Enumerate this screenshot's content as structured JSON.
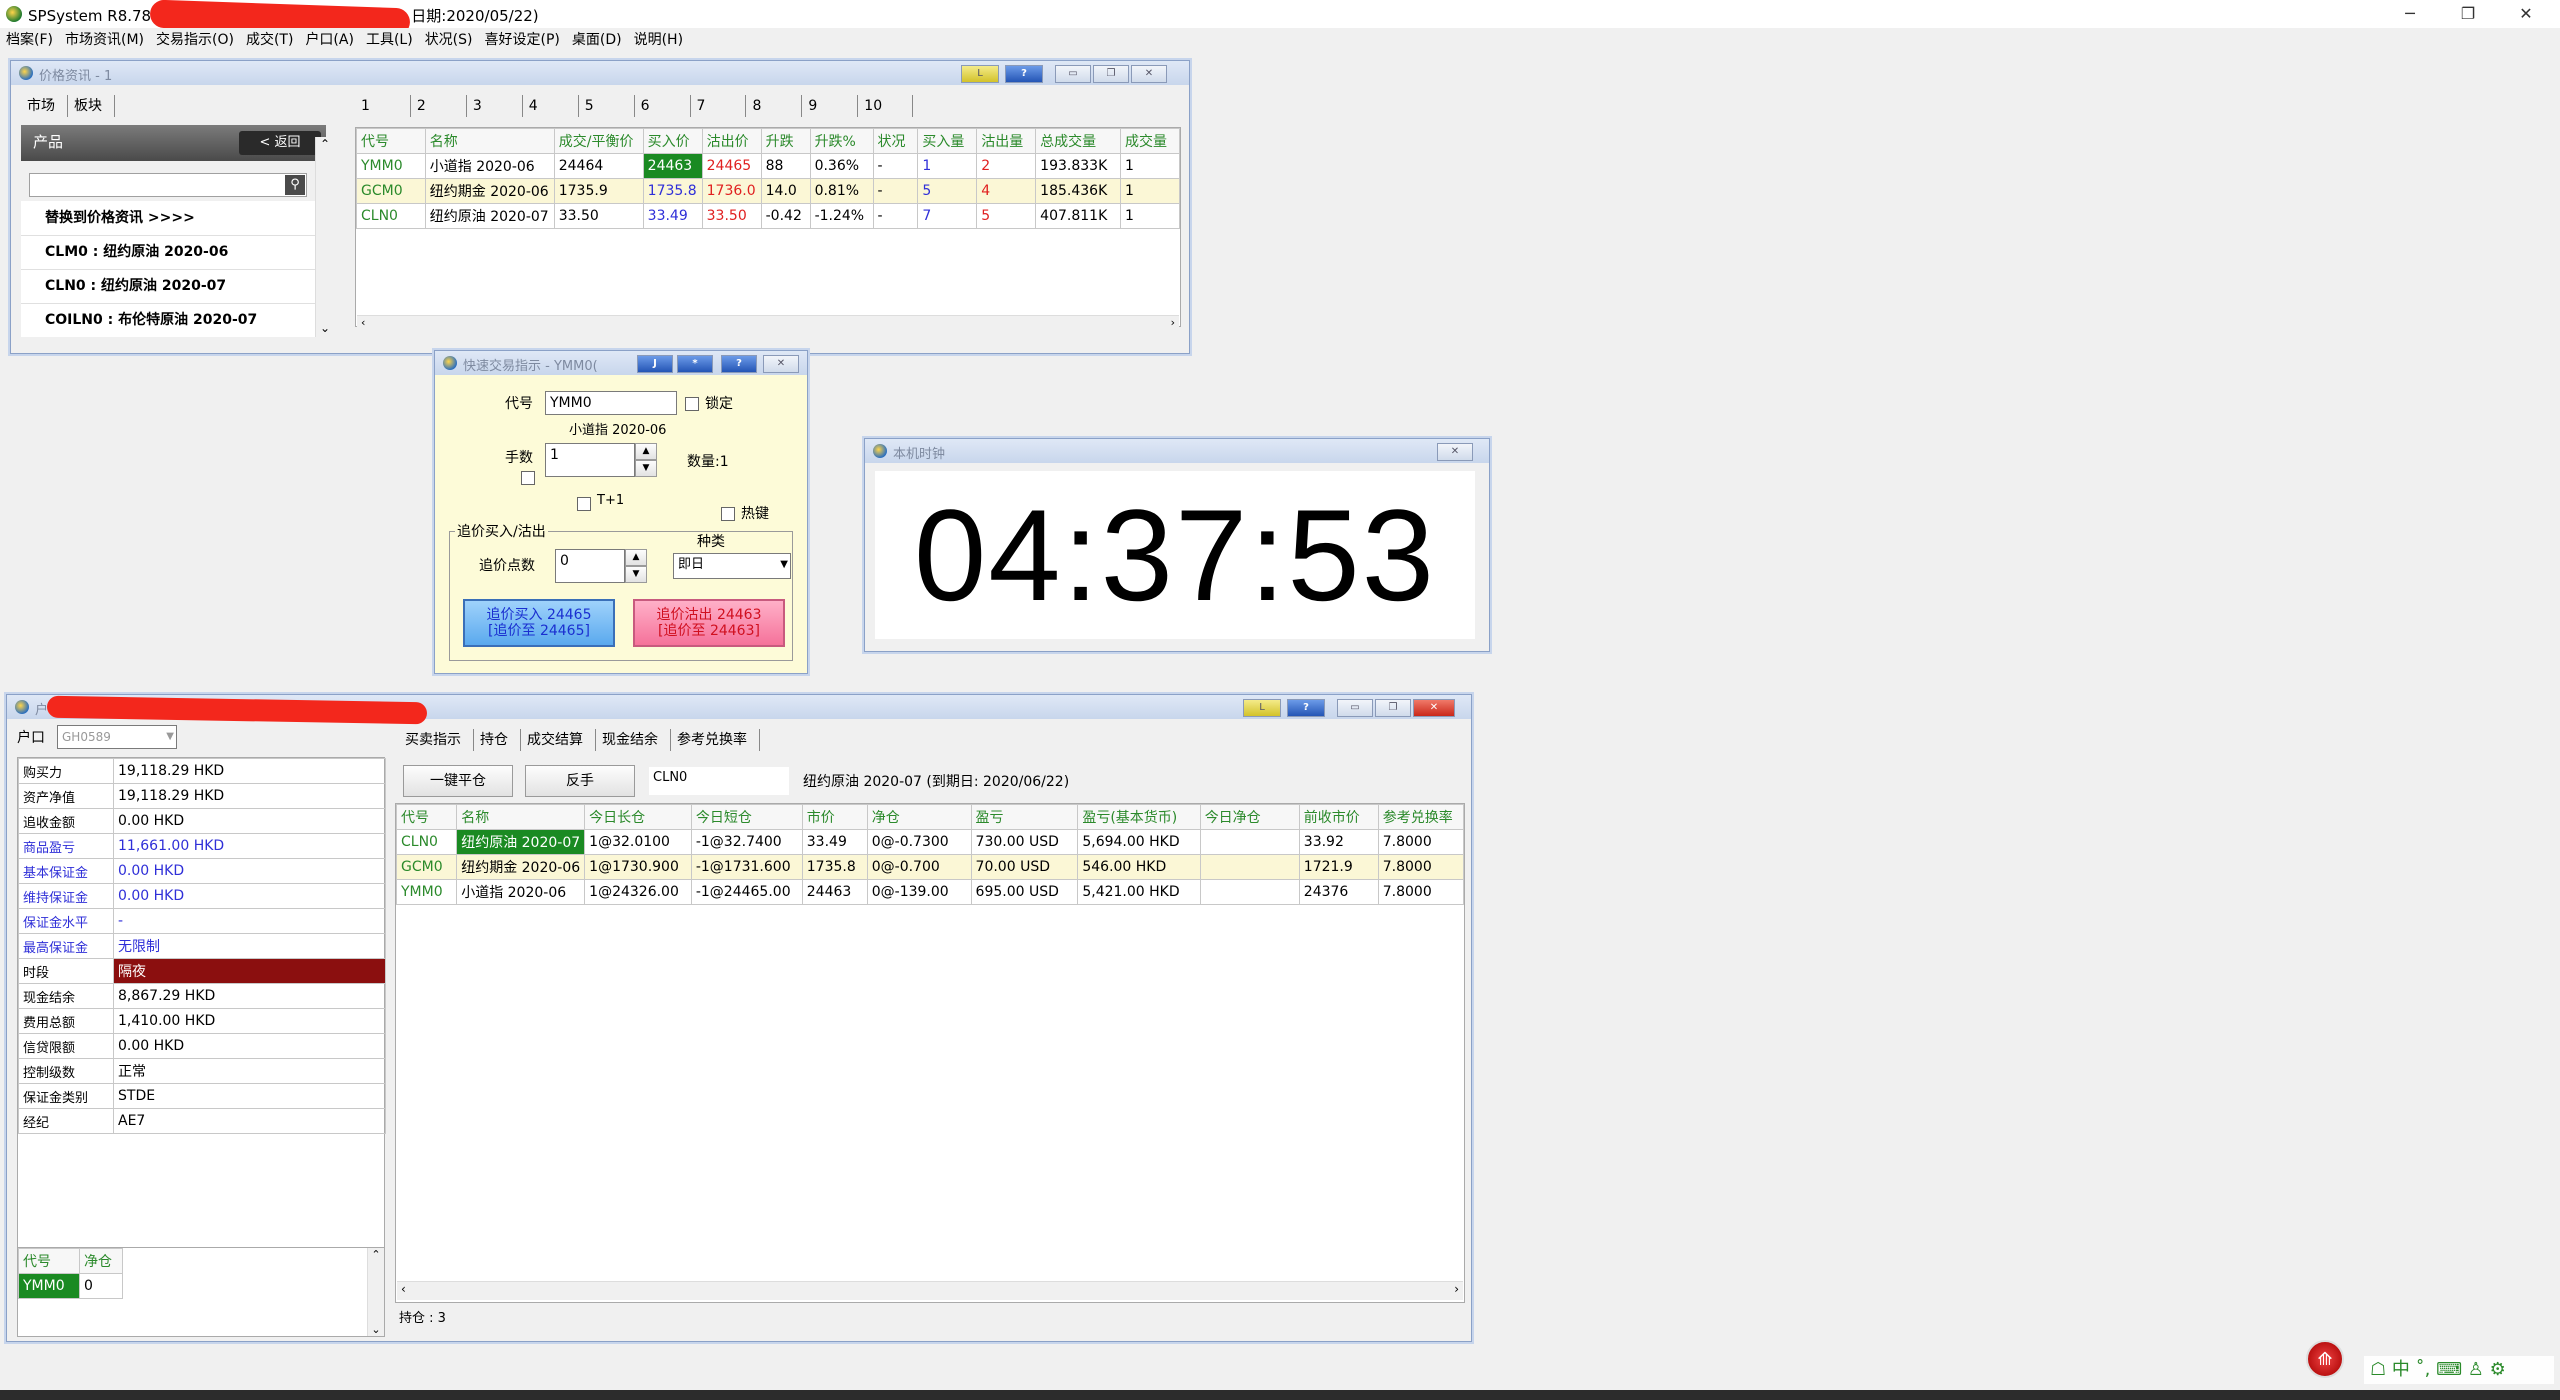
{
  "app": {
    "title_prefix": "SPSystem R8.78 -",
    "title_suffix": "日期:2020/05/22)",
    "window_controls": [
      "─",
      "❐",
      "✕"
    ]
  },
  "menu": [
    "档案(F)",
    "市场资讯(M)",
    "交易指示(O)",
    "成交(T)",
    "户口(A)",
    "工具(L)",
    "状况(S)",
    "喜好设定(P)",
    "桌面(D)",
    "说明(H)"
  ],
  "price_window": {
    "title": "价格资讯 - 1",
    "btn_l": "L",
    "btn_q": "?",
    "left_tabs": [
      "市场",
      "板块"
    ],
    "product_header": "产品",
    "back_button": "< 返回",
    "list": [
      "替换到价格资讯 >>>>",
      "CLM0 : 纽约原油 2020-06",
      "CLN0 : 纽约原油 2020-07",
      "COILN0 : 布伦特原油 2020-07"
    ],
    "page_tabs": [
      "1",
      "2",
      "3",
      "4",
      "5",
      "6",
      "7",
      "8",
      "9",
      "10"
    ],
    "headers": [
      "代号",
      "名称",
      "成交/平衡价",
      "买入价",
      "沽出价",
      "升跌",
      "升跌%",
      "状况",
      "买入量",
      "沽出量",
      "总成交量",
      "成交量"
    ],
    "rows": [
      [
        "YMM0",
        "小道指 2020-06",
        "24464",
        "24463",
        "24465",
        "88",
        "0.36%",
        "-",
        "1",
        "2",
        "193.833K",
        "1"
      ],
      [
        "GCM0",
        "纽约期金 2020-06",
        "1735.9",
        "1735.8",
        "1736.0",
        "14.0",
        "0.81%",
        "-",
        "5",
        "4",
        "185.436K",
        "1"
      ],
      [
        "CLN0",
        "纽约原油 2020-07",
        "33.50",
        "33.49",
        "33.50",
        "-0.42",
        "-1.24%",
        "-",
        "7",
        "5",
        "407.811K",
        "1"
      ]
    ]
  },
  "quick_order": {
    "title": "快速交易指示 - YMM0(",
    "btn_j": "J",
    "btn_star": "*",
    "btn_q": "?",
    "code_label": "代号",
    "code_value": "YMM0",
    "lock_label": "锁定",
    "product_name": "小道指 2020-06",
    "lots_label": "手数",
    "lots_value": "1",
    "qty_label": "数量:1",
    "t1_label": "T+1",
    "hotkey_label": "热键",
    "group_label": "追价买入/沽出",
    "chase_label": "追价点数",
    "chase_value": "0",
    "type_label": "种类",
    "type_value": "即日",
    "buy_line1": "追价买入 24465",
    "buy_line2": "[追价至 24465]",
    "sell_line1": "追价沽出 24463",
    "sell_line2": "[追价至 24463]"
  },
  "clock": {
    "title": "本机时钟",
    "time": "04:37:53"
  },
  "account": {
    "title_frag": "户",
    "account_label": "户口",
    "account_value": "GH0589",
    "fields": [
      {
        "label": "购买力",
        "value": "19,118.29 HKD",
        "label_color": "black"
      },
      {
        "label": "资产净值",
        "value": "19,118.29 HKD",
        "label_color": "black"
      },
      {
        "label": "追收金额",
        "value": "0.00 HKD",
        "label_color": "black"
      },
      {
        "label": "商品盈亏",
        "value": "11,661.00 HKD",
        "label_color": "blue"
      },
      {
        "label": "基本保证金",
        "value": "0.00 HKD",
        "label_color": "blue"
      },
      {
        "label": "维持保证金",
        "value": "0.00 HKD",
        "label_color": "blue"
      },
      {
        "label": "保证金水平",
        "value": "-",
        "label_color": "blue"
      },
      {
        "label": "最高保证金",
        "value": "无限制",
        "label_color": "blue"
      },
      {
        "label": "时段",
        "value": "隔夜",
        "label_color": "black"
      },
      {
        "label": "现金结余",
        "value": "8,867.29 HKD",
        "label_color": "black"
      },
      {
        "label": "费用总额",
        "value": "1,410.00 HKD",
        "label_color": "black"
      },
      {
        "label": "信贷限额",
        "value": "0.00 HKD",
        "label_color": "black"
      },
      {
        "label": "控制级数",
        "value": "正常",
        "label_color": "black"
      },
      {
        "label": "保证金类别",
        "value": "STDE",
        "label_color": "black"
      },
      {
        "label": "经纪",
        "value": "AE7",
        "label_color": "black"
      }
    ],
    "mini_headers": [
      "代号",
      "净仓"
    ],
    "mini_row": [
      "YMM0",
      "0"
    ],
    "tabs": [
      "买卖指示",
      "持仓",
      "成交结算",
      "现金结余",
      "参考兑换率"
    ],
    "flatten_button": "一键平仓",
    "reverse_button": "反手",
    "selected_code": "CLN0",
    "selected_desc": "纽约原油  2020-07  (到期日:  2020/06/22)",
    "pos_headers": [
      "代号",
      "名称",
      "今日长仓",
      "今日短仓",
      "市价",
      "净仓",
      "盈亏",
      "盈亏(基本货币)",
      "今日净仓",
      "前收市价",
      "参考兑换率"
    ],
    "pos_rows": [
      [
        "CLN0",
        "纽约原油 2020-07",
        "1@32.0100",
        "-1@32.7400",
        "33.49",
        "0@-0.7300",
        "730.00 USD",
        "5,694.00 HKD",
        "",
        "33.92",
        "7.8000"
      ],
      [
        "GCM0",
        "纽约期金 2020-06",
        "1@1730.900",
        "-1@1731.600",
        "1735.8",
        "0@-0.700",
        "70.00 USD",
        "546.00 HKD",
        "",
        "1721.9",
        "7.8000"
      ],
      [
        "YMM0",
        "小道指 2020-06",
        "1@24326.00",
        "-1@24465.00",
        "24463",
        "0@-139.00",
        "695.00 USD",
        "5,421.00 HKD",
        "",
        "24376",
        "7.8000"
      ]
    ],
    "status": "持仓 : 3"
  },
  "taskbar": {
    "ime": "中"
  }
}
